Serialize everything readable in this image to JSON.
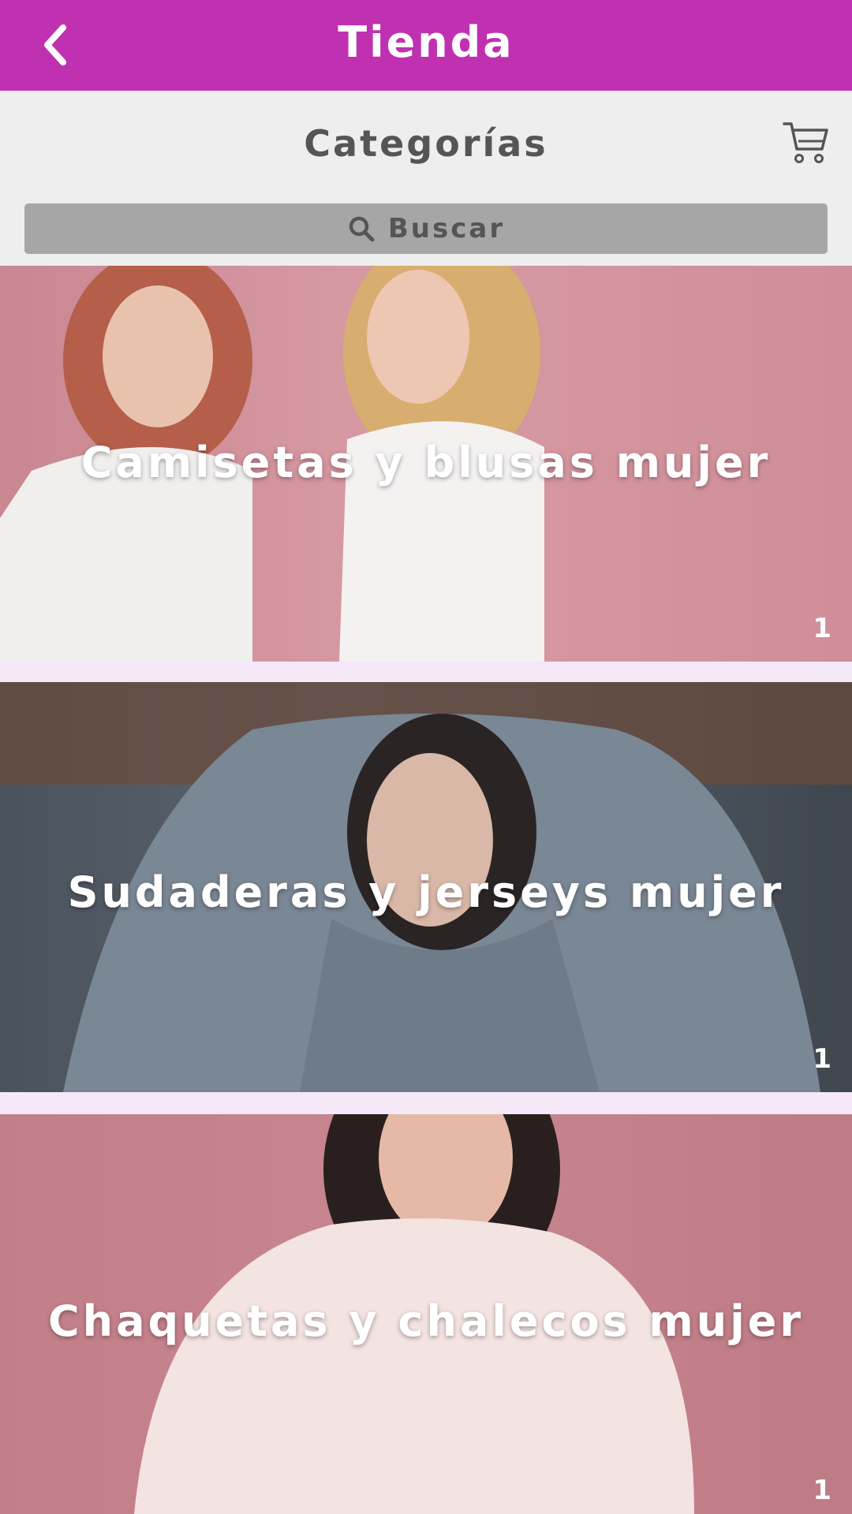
{
  "app_bar": {
    "title": "Tienda",
    "back_icon": "chevron-left-icon",
    "background": "#bf31b0"
  },
  "sub_header": {
    "title": "Categorías",
    "cart_icon": "shopping-cart-icon"
  },
  "search": {
    "placeholder": "Buscar",
    "icon": "search-icon"
  },
  "categories": [
    {
      "label": "Camisetas y blusas mujer",
      "count": "1",
      "background": "#d08b95"
    },
    {
      "label": "Sudaderas y jerseys mujer",
      "count": "1",
      "background": "#4f5a66"
    },
    {
      "label": "Chaquetas y chalecos mujer",
      "count": "1",
      "background": "#c4828c"
    }
  ]
}
